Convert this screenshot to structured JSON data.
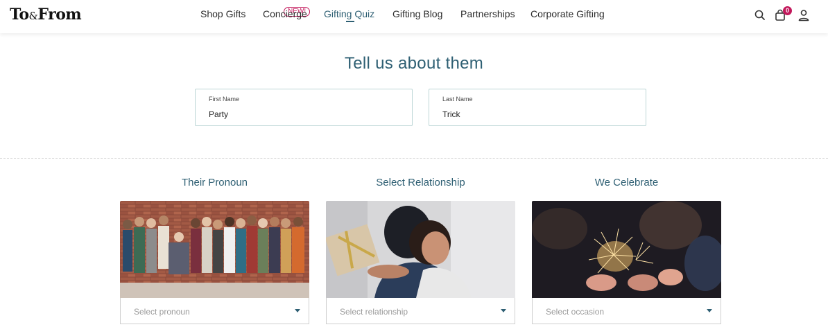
{
  "header": {
    "logo": {
      "part1": "To",
      "amp": "&",
      "part2": "From"
    },
    "nav": [
      {
        "label": "Shop Gifts"
      },
      {
        "label": "Concierge",
        "badge": "NEW!"
      },
      {
        "label": "Gifting Quiz",
        "active": true
      },
      {
        "label": "Gifting Blog"
      },
      {
        "label": "Partnerships"
      },
      {
        "label": "Corporate Gifting"
      }
    ],
    "icons": [
      "search-icon",
      "cart-icon",
      "user-icon"
    ],
    "cart_count": "0"
  },
  "main": {
    "title": "Tell us about them",
    "first_name": {
      "label": "First Name",
      "value": "Party"
    },
    "last_name": {
      "label": "Last Name",
      "value": "Trick"
    }
  },
  "cards": [
    {
      "title": "Their Pronoun",
      "placeholder": "Select pronoun",
      "image": "group-of-diverse-people-photo"
    },
    {
      "title": "Select Relationship",
      "placeholder": "Select relationship",
      "image": "hug-with-gift-photo"
    },
    {
      "title": "We Celebrate",
      "placeholder": "Select occasion",
      "image": "sparklers-celebration-photo"
    }
  ],
  "colors": {
    "accent": "#2e5f73",
    "brand_pink": "#c2185b",
    "field_border": "#bcd6d6"
  }
}
